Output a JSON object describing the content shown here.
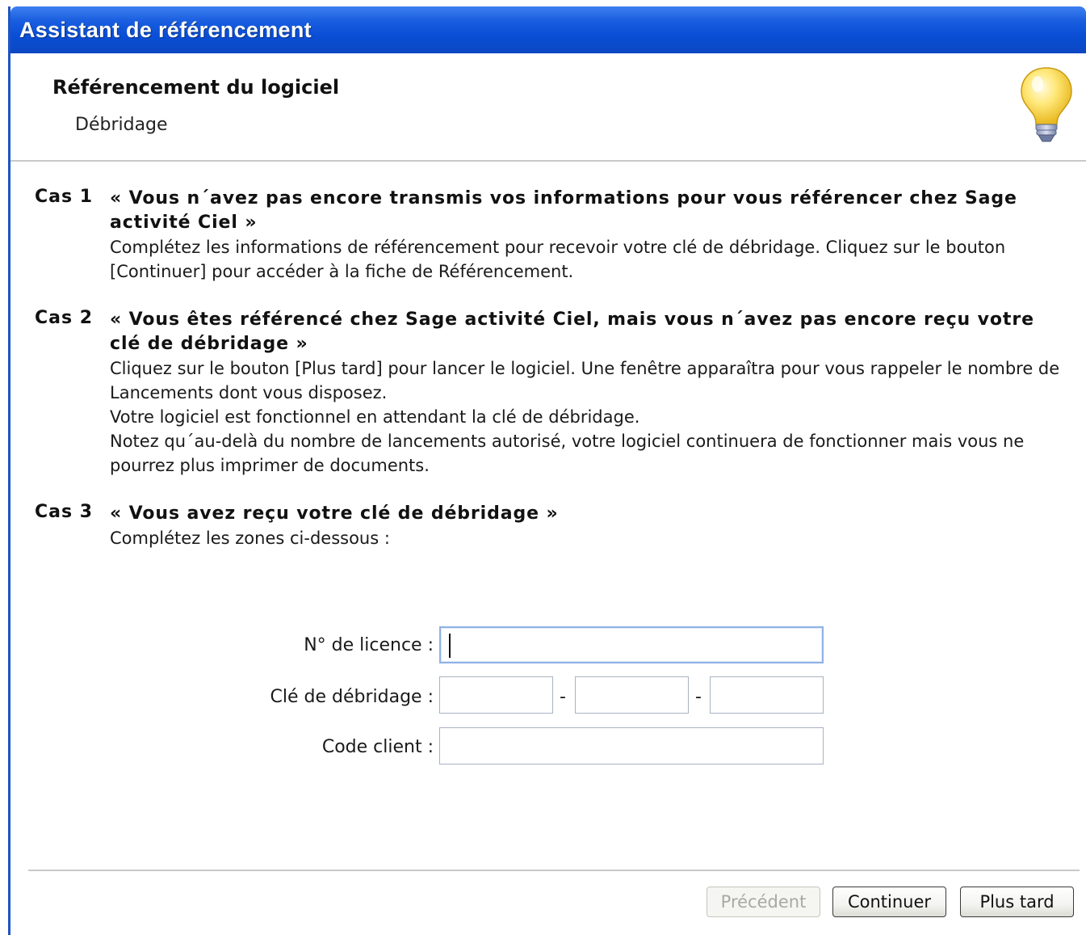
{
  "window": {
    "title": "Assistant de référencement"
  },
  "header": {
    "title": "Référencement du logiciel",
    "subtitle": "Débridage",
    "icon": "lightbulb-icon"
  },
  "cases": [
    {
      "label": "Cas 1",
      "heading": "« Vous n´avez pas encore transmis vos informations pour vous référencer chez Sage activité Ciel »",
      "lines": [
        "Complétez les informations de référencement pour recevoir votre clé de débridage. Cliquez sur le bouton [Continuer] pour accéder à la fiche de Référencement."
      ]
    },
    {
      "label": "Cas 2",
      "heading": "« Vous êtes référencé chez Sage activité Ciel, mais vous n´avez pas encore reçu votre clé de débridage »",
      "lines": [
        "Cliquez sur le bouton [Plus tard] pour lancer le logiciel. Une fenêtre apparaîtra pour vous rappeler le nombre de Lancements dont vous disposez.",
        "Votre logiciel est fonctionnel en attendant la clé de débridage.",
        "Notez qu´au-delà du nombre de lancements autorisé, votre logiciel continuera de fonctionner mais vous ne pourrez plus imprimer de documents."
      ]
    },
    {
      "label": "Cas 3",
      "heading": "« Vous avez reçu votre clé de débridage »",
      "lines": [
        "Complétez les zones ci-dessous :"
      ]
    }
  ],
  "form": {
    "licence_label": "N° de licence :",
    "licence_value": "",
    "key_label": "Clé de débridage :",
    "key_separator": "-",
    "key_parts": [
      "",
      "",
      ""
    ],
    "client_label": "Code client :",
    "client_value": ""
  },
  "buttons": {
    "previous": "Précédent",
    "continue": "Continuer",
    "later": "Plus tard"
  },
  "colors": {
    "titlebar": "#0a4fd6",
    "window_border": "#1f54c4",
    "focus_border": "#8fb2e6"
  }
}
